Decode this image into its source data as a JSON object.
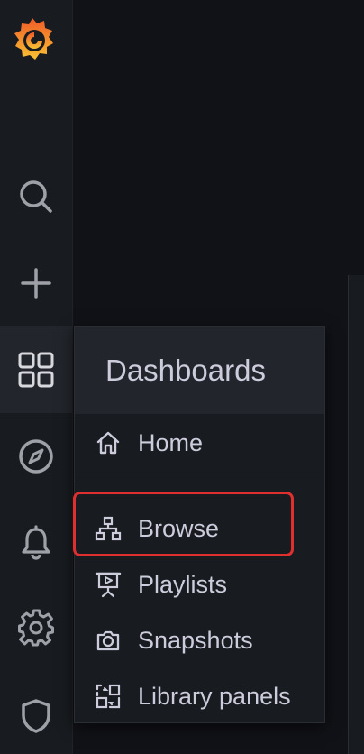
{
  "sidebar": {
    "logo": "grafana-logo",
    "items": [
      {
        "icon": "search-icon"
      },
      {
        "icon": "plus-icon"
      },
      {
        "icon": "dashboards-grid-icon",
        "active": true
      },
      {
        "icon": "compass-icon"
      },
      {
        "icon": "bell-icon"
      },
      {
        "icon": "gear-icon"
      },
      {
        "icon": "shield-icon"
      }
    ]
  },
  "menu": {
    "title": "Dashboards",
    "items": [
      {
        "label": "Home",
        "icon": "home-icon"
      },
      {
        "label": "Browse",
        "icon": "sitemap-icon",
        "highlighted": true
      },
      {
        "label": "Playlists",
        "icon": "presentation-icon"
      },
      {
        "label": "Snapshots",
        "icon": "camera-icon"
      },
      {
        "label": "Library panels",
        "icon": "library-panels-icon"
      }
    ]
  },
  "colors": {
    "sidebar_bg": "#181b1f",
    "page_bg": "#111217",
    "text": "#ccccdc",
    "highlight": "#e02f2f"
  }
}
